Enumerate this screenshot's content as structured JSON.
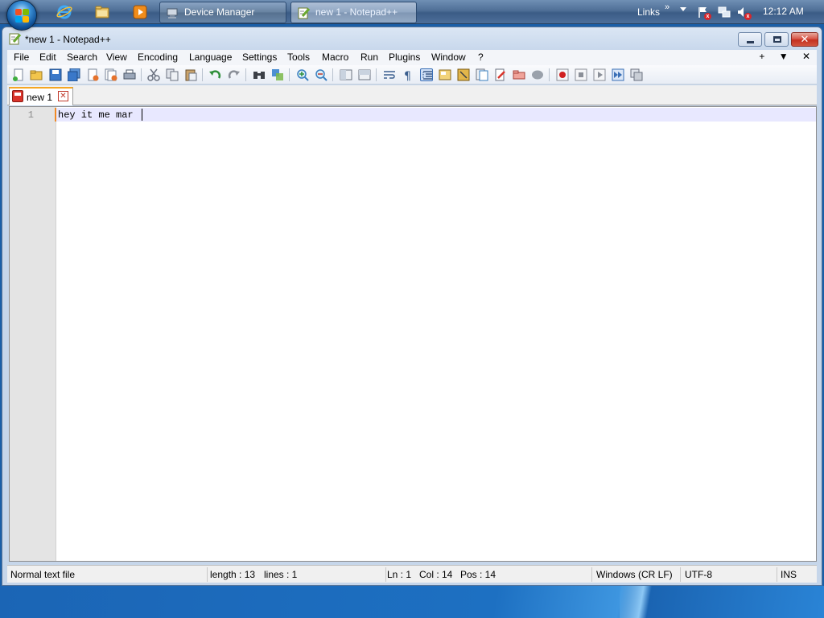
{
  "taskbar": {
    "tasks": [
      {
        "label": "Device Manager"
      },
      {
        "label": "new 1 - Notepad++"
      }
    ],
    "links_label": "Links",
    "links_chevron": "»",
    "clock": "12:12 AM"
  },
  "window": {
    "title": "*new 1 - Notepad++",
    "close_glyph": "✕"
  },
  "menu": {
    "items": [
      "File",
      "Edit",
      "Search",
      "View",
      "Encoding",
      "Language",
      "Settings",
      "Tools",
      "Macro",
      "Run",
      "Plugins",
      "Window",
      "?"
    ],
    "right": [
      "+",
      "▼",
      "✕"
    ]
  },
  "tabs": [
    {
      "label": "new 1",
      "close_glyph": "✕"
    }
  ],
  "editor": {
    "line_number": "1",
    "line_text": "hey it me mar"
  },
  "status": {
    "file_type": "Normal text file",
    "length": "length : 13",
    "lines": "lines : 1",
    "ln": "Ln : 1",
    "col": "Col : 14",
    "pos": "Pos : 14",
    "eol": "Windows (CR LF)",
    "encoding": "UTF-8",
    "mode": "INS"
  },
  "colors": {
    "taskbar": "#4f6f97",
    "current_line": "#e8e8ff",
    "tab_accent": "#f5a623"
  },
  "icons": {
    "taskbar": [
      "start-orb",
      "internet-explorer-icon",
      "folder-icon",
      "media-player-icon",
      "device-manager-icon",
      "notepadpp-icon",
      "action-center-flag-icon",
      "network-icon",
      "volume-icon"
    ],
    "toolbar": [
      "new-file-icon",
      "open-file-icon",
      "save-icon",
      "save-all-icon",
      "close-icon",
      "close-all-icon",
      "print-icon",
      "cut-icon",
      "copy-icon",
      "paste-icon",
      "undo-icon",
      "redo-icon",
      "find-icon",
      "replace-icon",
      "zoom-in-icon",
      "zoom-out-icon",
      "sync-vertical-icon",
      "sync-horizontal-icon",
      "word-wrap-icon",
      "show-all-chars-icon",
      "indent-guide-icon",
      "user-defined-language-icon",
      "doc-map-icon",
      "function-list-icon",
      "folder-as-workspace-icon",
      "monitoring-icon",
      "record-macro-icon",
      "stop-macro-icon",
      "play-macro-icon",
      "run-macro-multiple-icon",
      "save-macro-icon"
    ]
  }
}
